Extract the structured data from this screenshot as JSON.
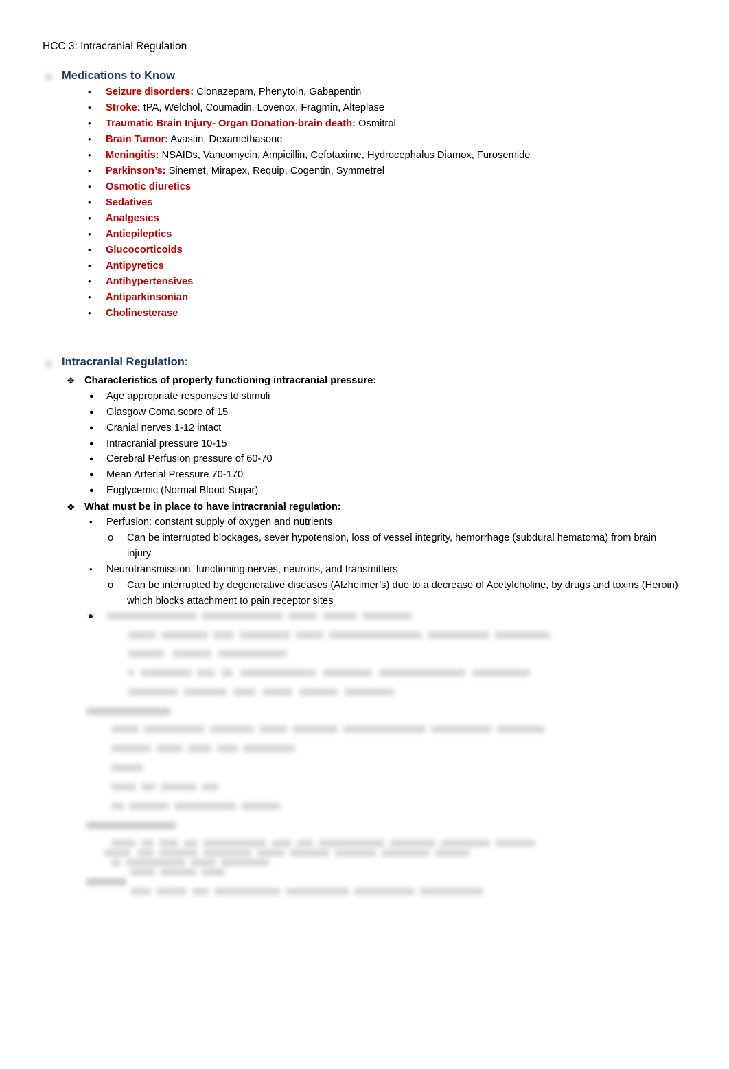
{
  "document": {
    "title": "HCC 3: Intracranial Regulation",
    "colors": {
      "heading_blue": "#1F3864",
      "accent_red": "#C00000",
      "body_black": "#000000",
      "page_background": "#FFFFFF"
    }
  },
  "markers": {
    "disc": "•",
    "small_disc": "●",
    "diamond": "❖",
    "hollow_o": "o"
  },
  "sections": {
    "medications": {
      "heading": "Medications to Know",
      "items": [
        {
          "label": "Seizure disorders:",
          "detail": " Clonazepam, Phenytoin, Gabapentin"
        },
        {
          "label": "Stroke:",
          "detail": " tPA, Welchol, Coumadin, Lovenox, Fragmin, Alteplase"
        },
        {
          "label": "Traumatic Brain Injury- Organ Donation-brain death:",
          "detail": " Osmitrol"
        },
        {
          "label": "Brain Tumor:",
          "detail": " Avastin, Dexamethasone"
        },
        {
          "label": "Meningitis:",
          "detail": " NSAIDs, Vancomycin, Ampicillin, Cefotaxime, Hydrocephalus Diamox, Furosemide"
        },
        {
          "label": "Parkinson’s:",
          "detail": " Sinemet, Mirapex, Requip, Cogentin, Symmetrel"
        },
        {
          "label": "Osmotic diuretics",
          "detail": ""
        },
        {
          "label": "Sedatives",
          "detail": ""
        },
        {
          "label": "Analgesics",
          "detail": ""
        },
        {
          "label": "Antiepileptics",
          "detail": ""
        },
        {
          "label": "Glucocorticoids",
          "detail": ""
        },
        {
          "label": "Antipyretics",
          "detail": ""
        },
        {
          "label": "Antihypertensives",
          "detail": ""
        },
        {
          "label": "Antiparkinsonian",
          "detail": ""
        },
        {
          "label": "Cholinesterase",
          "detail": ""
        }
      ]
    },
    "intracranial_regulation": {
      "heading": "Intracranial Regulation:",
      "subsection_1": {
        "heading": "Characteristics of properly functioning intracranial pressure:",
        "items": [
          "Age appropriate responses to stimuli",
          "Glasgow Coma score of 15",
          "Cranial nerves 1-12 intact",
          "Intracranial pressure 10-15",
          "Cerebral Perfusion pressure of 60-70",
          "Mean Arterial Pressure 70-170",
          "Euglycemic (Normal Blood Sugar)"
        ]
      },
      "subsection_2": {
        "heading": "What must be in place to have intracranial regulation:",
        "items": [
          {
            "text": "Perfusion: constant supply of oxygen and nutrients",
            "sub": [
              "Can be interrupted blockages, sever hypotension, loss of vessel integrity, hemorrhage (subdural hematoma) from brain injury"
            ]
          },
          {
            "text": "Neurotransmission: functioning nerves, neurons, and transmitters",
            "sub": [
              "Can be interrupted by degenerative diseases (Alzheimer’s) due to a decrease of Acetylcholine, by drugs and toxins (Heroin) which blocks attachment to pain receptor sites"
            ]
          }
        ]
      },
      "obscured_tail": {
        "note": "Remaining content is blurred and illegible in the screenshot."
      }
    }
  }
}
